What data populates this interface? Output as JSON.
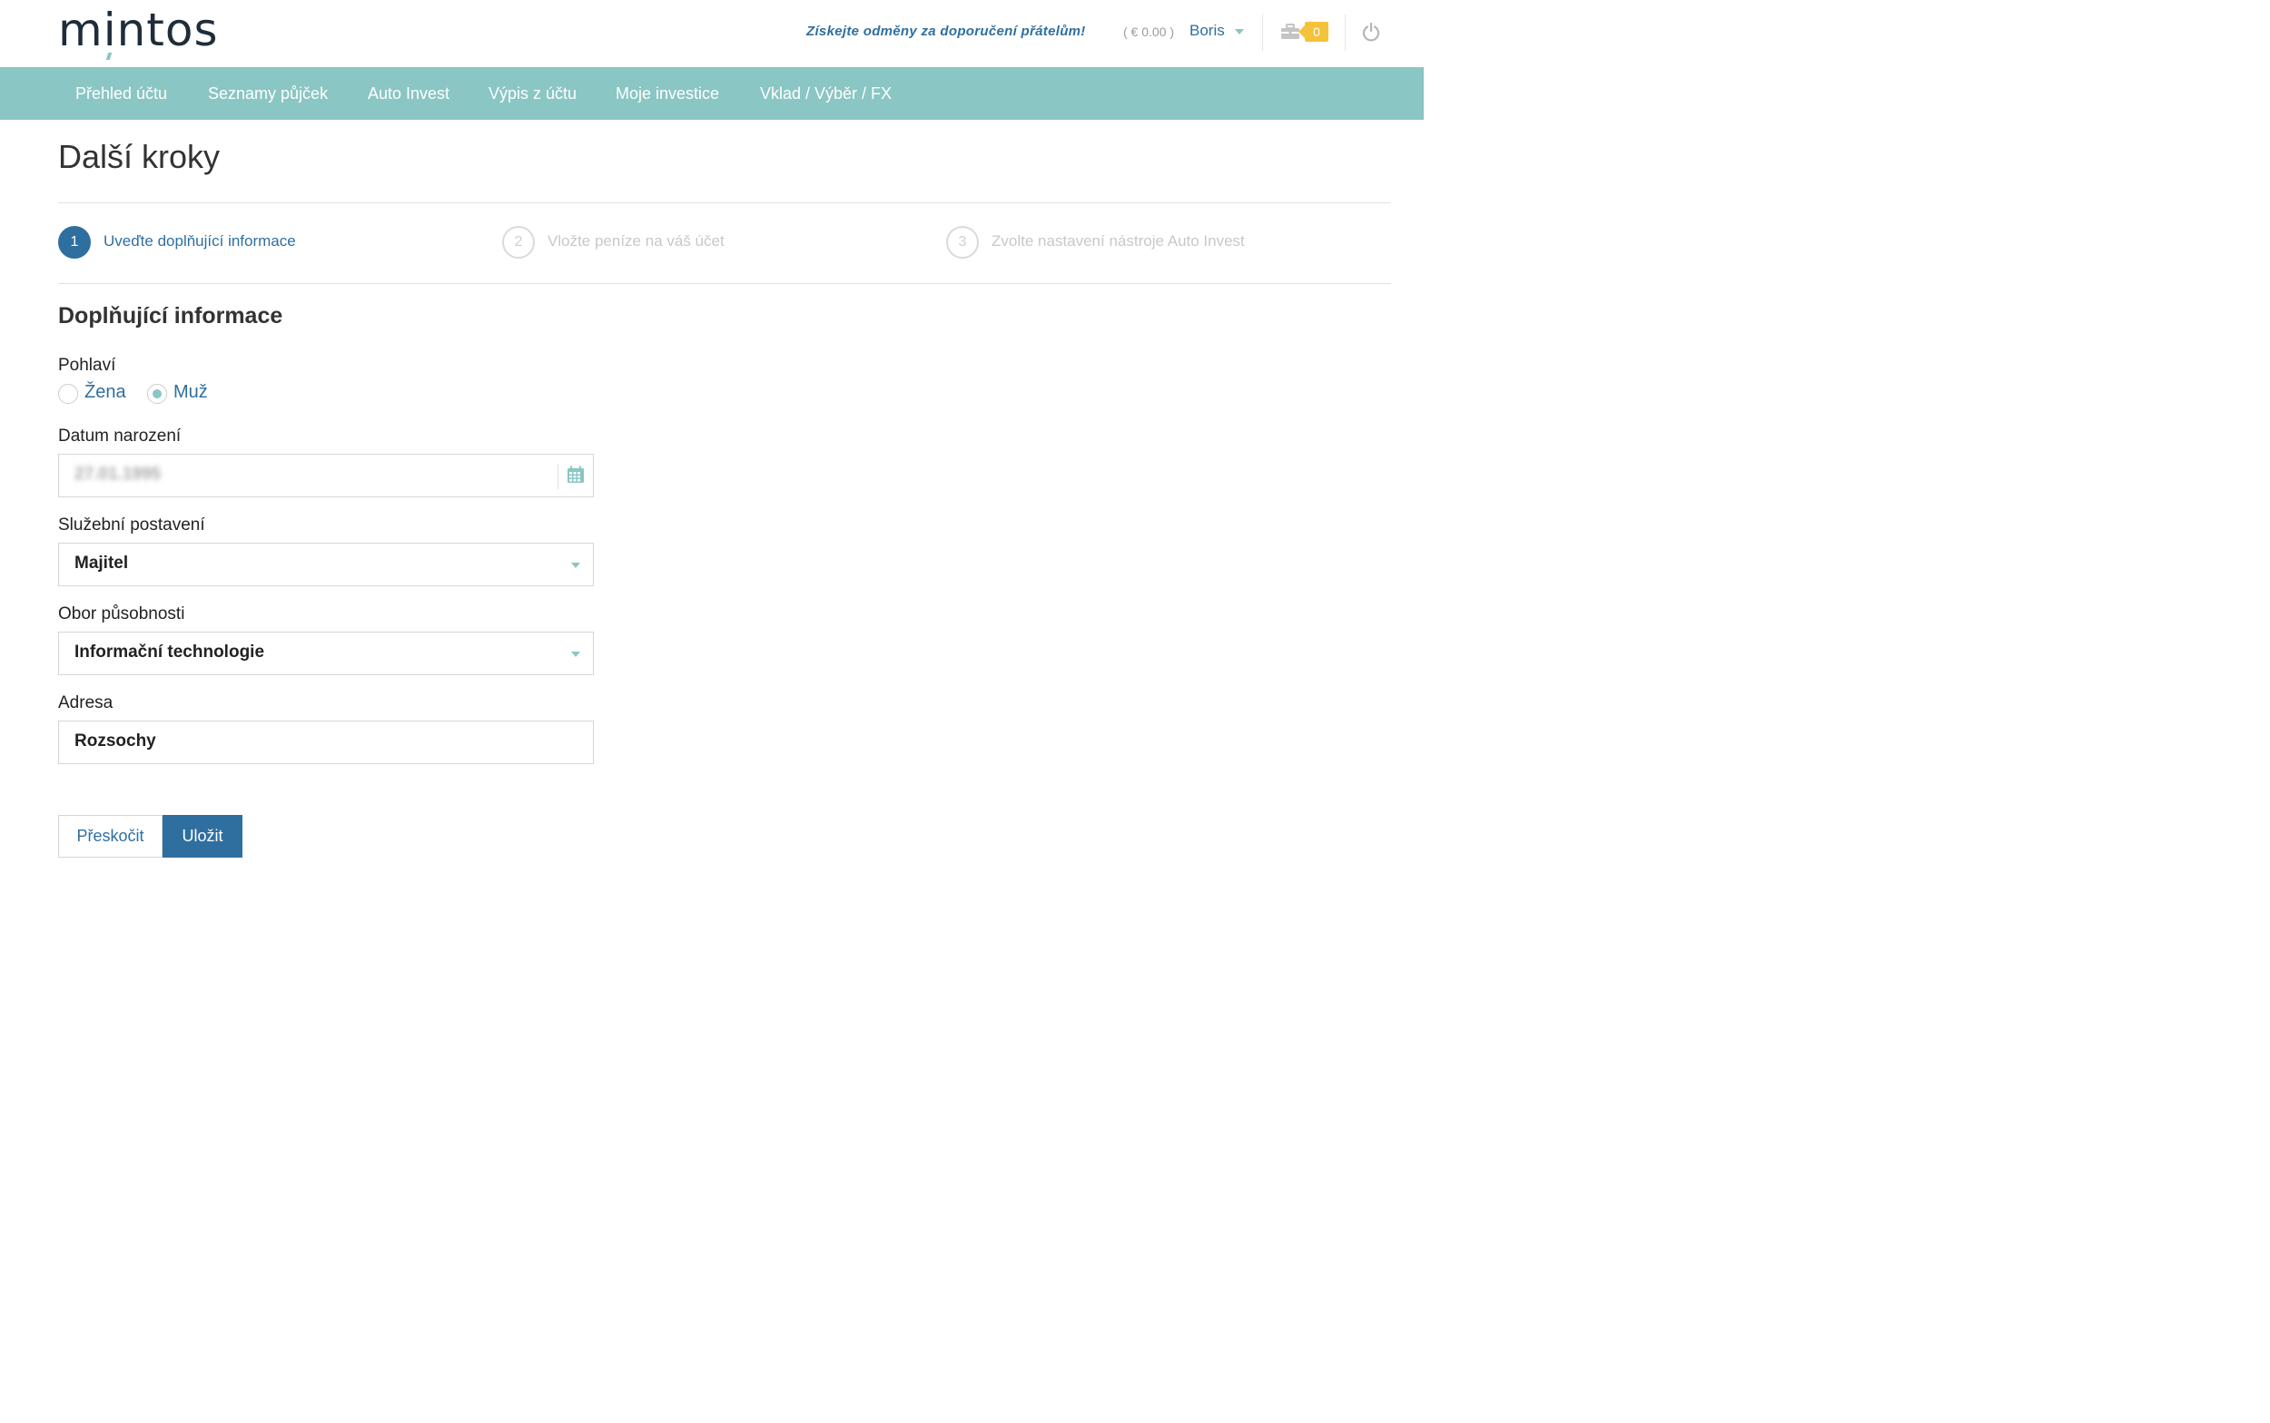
{
  "header": {
    "logo": "mintos",
    "referral_link": "Získejte odměny za doporučení přátelům!",
    "balance": "( € 0.00 )",
    "user_name": "Boris",
    "cart_count": "0"
  },
  "nav": {
    "items": [
      {
        "label": "Přehled účtu"
      },
      {
        "label": "Seznamy půjček"
      },
      {
        "label": "Auto Invest"
      },
      {
        "label": "Výpis z účtu"
      },
      {
        "label": "Moje investice"
      },
      {
        "label": "Vklad / Výběr / FX"
      }
    ]
  },
  "page": {
    "title": "Další kroky"
  },
  "steps": [
    {
      "number": "1",
      "label": "Uveďte doplňující informace",
      "state": "active"
    },
    {
      "number": "2",
      "label": "Vložte peníze na váš účet",
      "state": "inactive"
    },
    {
      "number": "3",
      "label": "Zvolte nastavení nástroje Auto Invest",
      "state": "inactive"
    }
  ],
  "form": {
    "section_title": "Doplňující informace",
    "gender": {
      "label": "Pohlaví",
      "options": [
        {
          "label": "Žena",
          "checked": false
        },
        {
          "label": "Muž",
          "checked": true
        }
      ]
    },
    "birth_date": {
      "label": "Datum narození",
      "value": "27.01.1995"
    },
    "employment": {
      "label": "Služební postavení",
      "value": "Majitel"
    },
    "industry": {
      "label": "Obor působnosti",
      "value": "Informační technologie"
    },
    "address": {
      "label": "Adresa",
      "value": "Rozsochy"
    },
    "buttons": {
      "skip": "Přeskočit",
      "save": "Uložit"
    }
  },
  "colors": {
    "nav_bg": "#8ac6c3",
    "primary": "#2f6fa0",
    "badge": "#f4c33b"
  }
}
